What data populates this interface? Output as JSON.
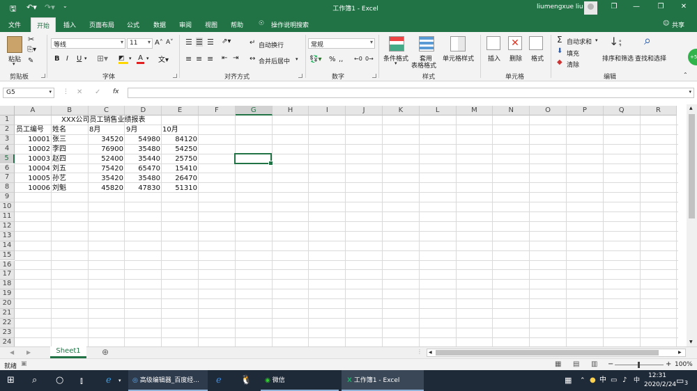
{
  "titlebar": {
    "title": "工作簿1  -  Excel",
    "user": "liumengxue liu"
  },
  "tabs": [
    {
      "label": "文件"
    },
    {
      "label": "开始"
    },
    {
      "label": "插入"
    },
    {
      "label": "页面布局"
    },
    {
      "label": "公式"
    },
    {
      "label": "数据"
    },
    {
      "label": "审阅"
    },
    {
      "label": "视图"
    },
    {
      "label": "帮助"
    },
    {
      "label": "操作说明搜索"
    }
  ],
  "share_label": "共享",
  "ribbon": {
    "clipboard": {
      "label": "剪贴板",
      "paste": "粘贴"
    },
    "font": {
      "label": "字体",
      "name": "等线",
      "size": "11",
      "bold": "B",
      "italic": "I",
      "underline": "U"
    },
    "alignment": {
      "label": "对齐方式",
      "wrap": "自动换行",
      "merge": "合并后居中"
    },
    "number": {
      "label": "数字",
      "format": "常规",
      "percent": "%"
    },
    "styles": {
      "label": "样式",
      "conditional": "条件格式",
      "table_line1": "套用",
      "table_line2": "表格格式",
      "cell_styles": "单元格样式"
    },
    "cells": {
      "label": "单元格",
      "insert": "插入",
      "delete": "删除",
      "format": "格式"
    },
    "editing": {
      "label": "编辑",
      "autosum": "自动求和",
      "fill": "填充",
      "clear": "清除",
      "sort": "排序和筛选",
      "find": "查找和选择"
    }
  },
  "formula_bar": {
    "name_box": "G5",
    "fx": "fx",
    "content": ""
  },
  "columns": [
    "A",
    "B",
    "C",
    "D",
    "E",
    "F",
    "G",
    "H",
    "I",
    "J",
    "K",
    "L",
    "M",
    "N",
    "O",
    "P",
    "Q",
    "R"
  ],
  "rows": [
    "1",
    "2",
    "3",
    "4",
    "5",
    "6",
    "7",
    "8",
    "9",
    "10",
    "11",
    "12",
    "13",
    "14",
    "15",
    "16",
    "17",
    "18",
    "19",
    "20",
    "21",
    "22",
    "23",
    "24"
  ],
  "sheet": {
    "title": "XXX公司员工销售业绩报表",
    "headers": [
      "员工编号",
      "姓名",
      "8月",
      "9月",
      "10月"
    ],
    "data": [
      [
        "10001",
        "张三",
        "34520",
        "54980",
        "84120"
      ],
      [
        "10002",
        "李四",
        "76900",
        "35480",
        "54250"
      ],
      [
        "10003",
        "赵四",
        "52400",
        "35440",
        "25750"
      ],
      [
        "10004",
        "刘五",
        "75420",
        "65470",
        "15410"
      ],
      [
        "10005",
        "孙艺",
        "35420",
        "35480",
        "26470"
      ],
      [
        "10006",
        "刘魁",
        "45820",
        "47830",
        "51310"
      ]
    ]
  },
  "sheet_tab": "Sheet1",
  "status": {
    "mode": "就绪",
    "zoom": "100%"
  },
  "taskbar": {
    "item1": "高级编辑器_百度经...",
    "item2": "微信",
    "item3": "工作簿1 - Excel",
    "time": "12:31",
    "date": "2020/2/24",
    "ime": "中",
    "notif": "3"
  },
  "colors": {
    "accent": "#217346",
    "taskbar": "#1f2a38"
  }
}
